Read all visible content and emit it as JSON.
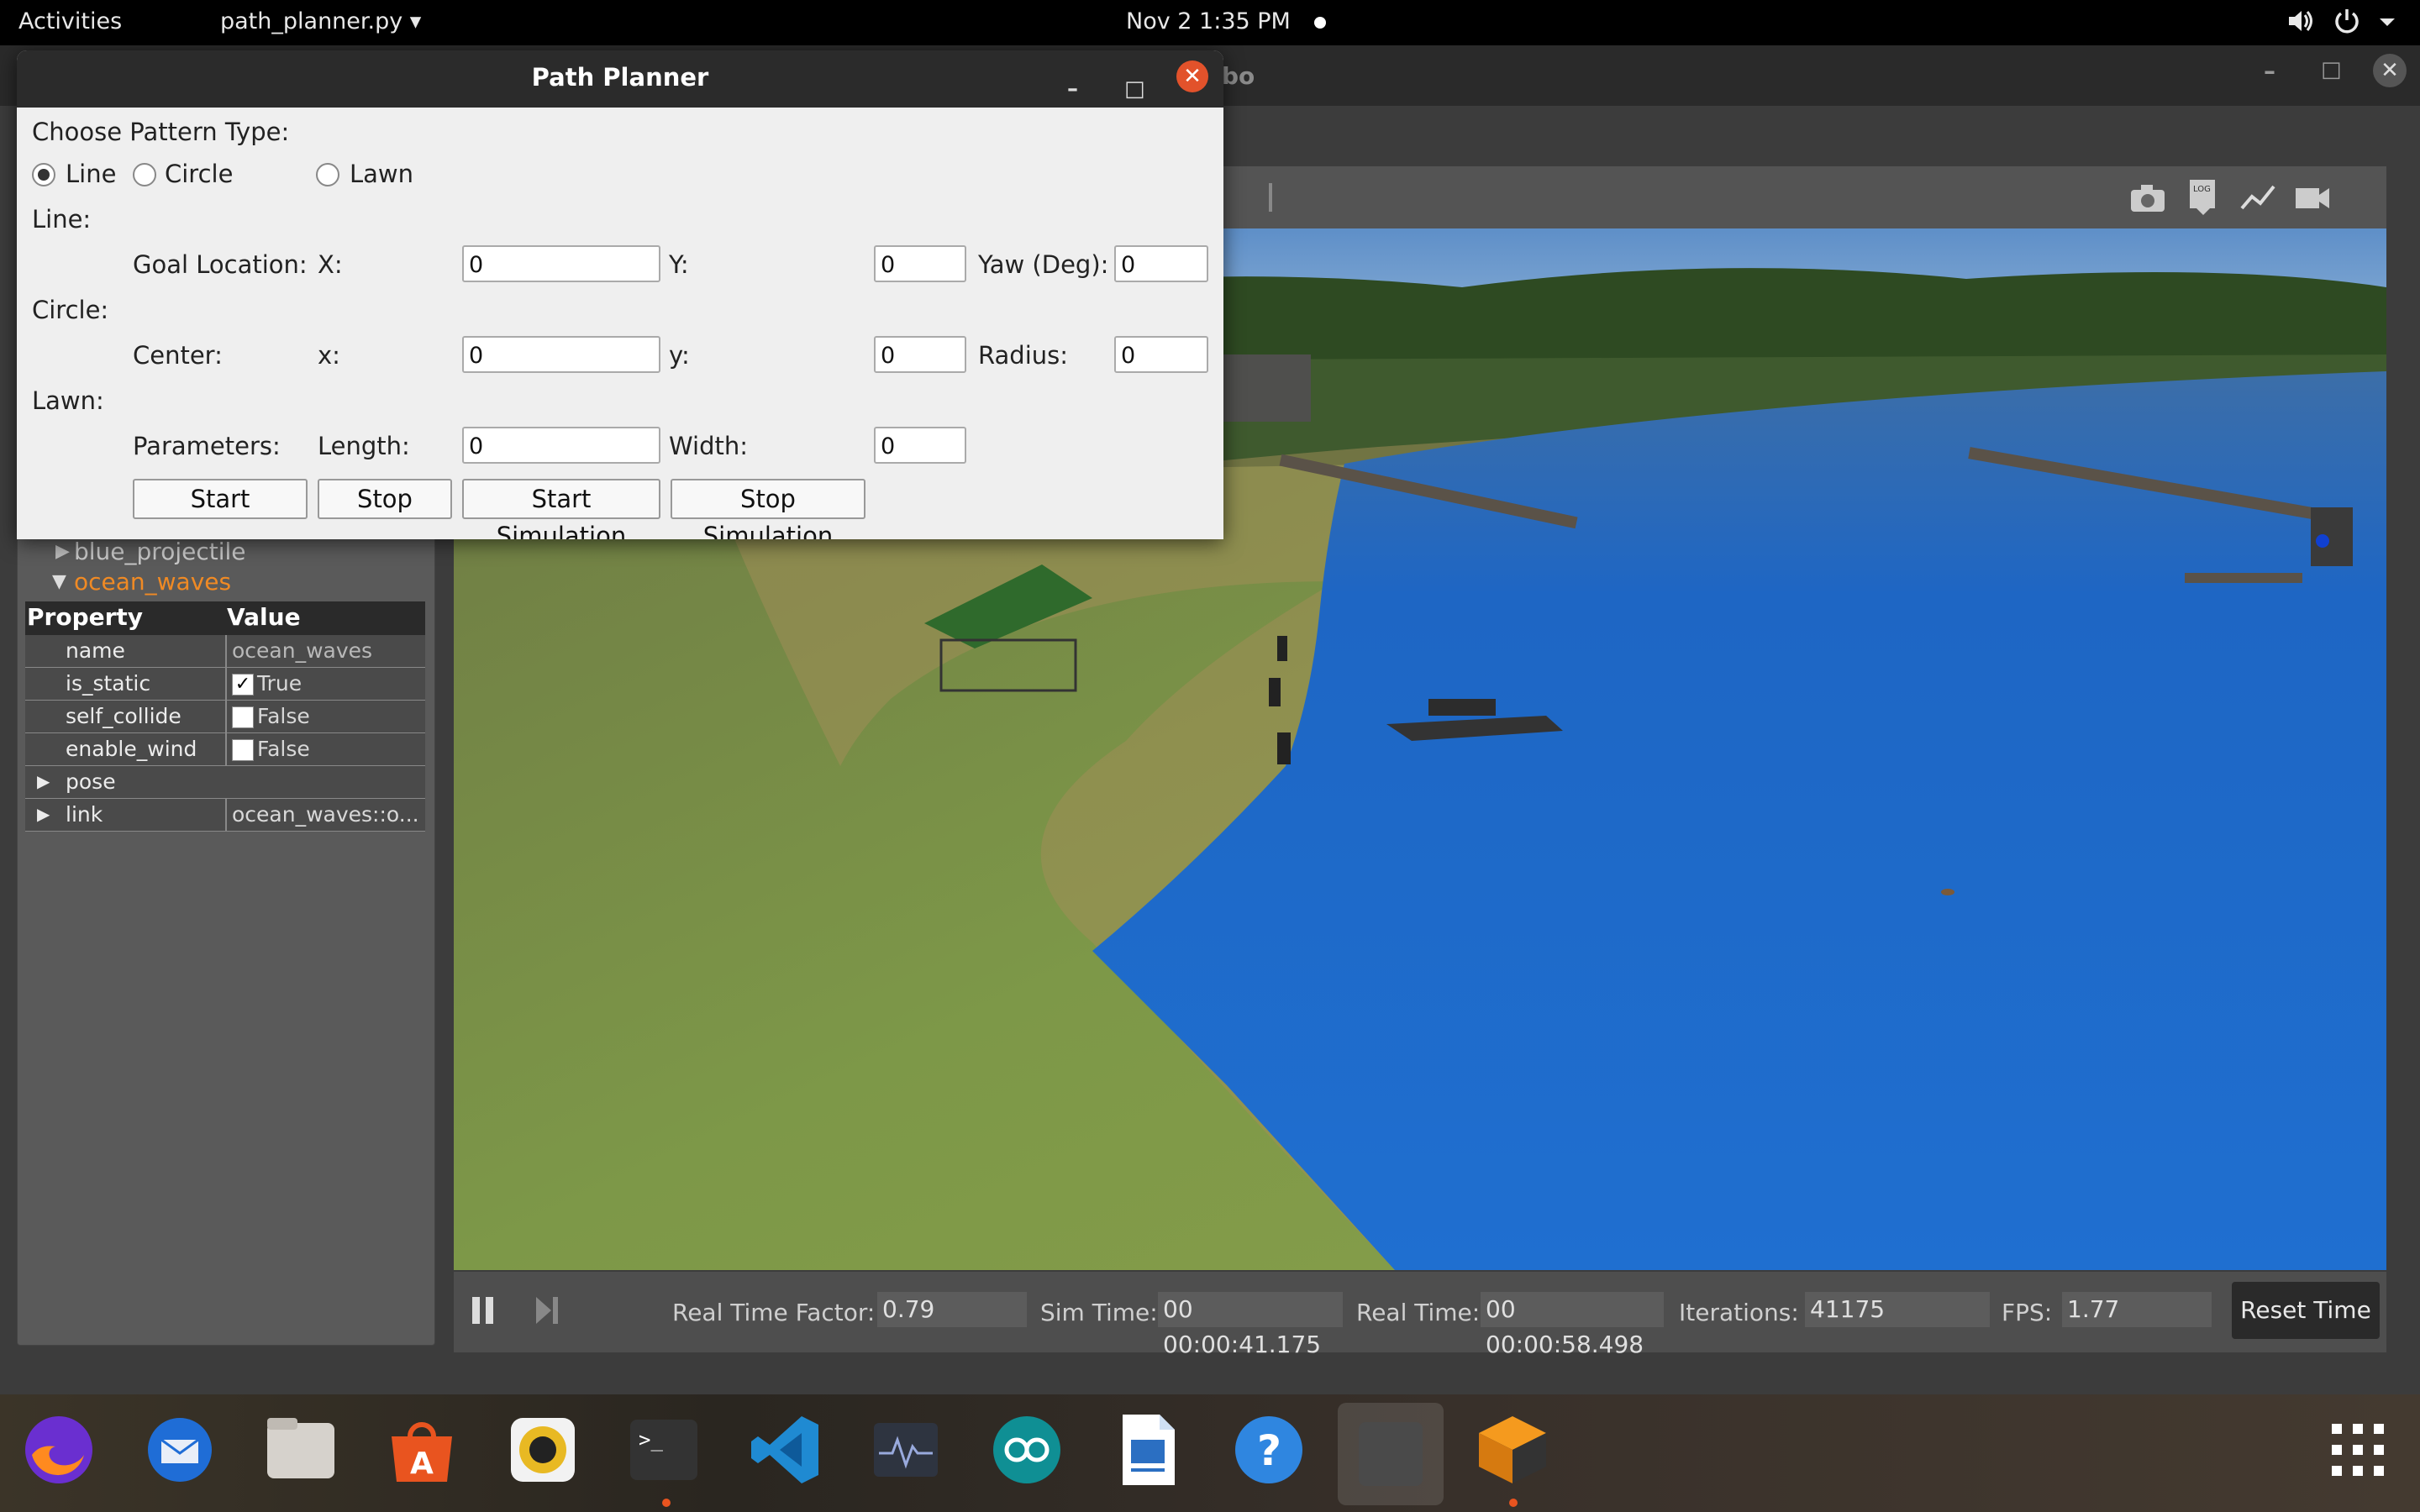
{
  "topbar": {
    "activities": "Activities",
    "app_menu": "path_planner.py ▾",
    "clock": "Nov 2  1:35 PM",
    "volume_icon": "volume-icon",
    "power_icon": "power-icon"
  },
  "gazebo": {
    "title_partial": "bo",
    "tree": {
      "item1": "blue_projectile",
      "item2": "ocean_waves"
    },
    "properties": {
      "col_property": "Property",
      "col_value": "Value",
      "rows": [
        {
          "key": "name",
          "value": "ocean_waves"
        },
        {
          "key": "is_static",
          "value": "True",
          "checked": true
        },
        {
          "key": "self_collide",
          "value": "False",
          "checked": false
        },
        {
          "key": "enable_wind",
          "value": "False",
          "checked": false
        },
        {
          "key": "pose",
          "value": ""
        },
        {
          "key": "link",
          "value": "ocean_waves::o..."
        }
      ]
    },
    "status": {
      "rtf_label": "Real Time Factor:",
      "rtf_value": "0.79",
      "sim_label": "Sim Time:",
      "sim_value": "00 00:00:41.175",
      "real_label": "Real Time:",
      "real_value": "00 00:00:58.498",
      "iter_label": "Iterations:",
      "iter_value": "41175",
      "fps_label": "FPS:",
      "fps_value": "1.77",
      "reset_label": "Reset Time"
    }
  },
  "dialog": {
    "title": "Path Planner",
    "choose_label": "Choose Pattern Type:",
    "radios": {
      "line": "Line",
      "circle": "Circle",
      "lawn": "Lawn",
      "selected": "line"
    },
    "line_section": "Line:",
    "goal_label": "Goal Location:",
    "x_label": "X:",
    "x_value": "0",
    "y_label": "Y:",
    "y_value": "0",
    "yaw_label": "Yaw (Deg):",
    "yaw_value": "0",
    "circle_section": "Circle:",
    "center_label": "Center:",
    "cx_label": "x:",
    "cx_value": "0",
    "cy_label": "y:",
    "cy_value": "0",
    "radius_label": "Radius:",
    "radius_value": "0",
    "lawn_section": "Lawn:",
    "params_label": "Parameters:",
    "length_label": "Length:",
    "length_value": "0",
    "width_label": "Width:",
    "width_value": "0",
    "buttons": {
      "start": "Start",
      "stop": "Stop",
      "start_sim": "Start Simulation",
      "stop_sim": "Stop Simulation"
    }
  },
  "dock": {
    "apps": [
      "firefox-icon",
      "thunderbird-icon",
      "files-icon",
      "app-center-icon",
      "rhythmbox-icon",
      "terminal-icon",
      "vscode-icon",
      "system-monitor-icon",
      "arduino-icon",
      "writer-icon",
      "help-icon",
      "gazebo-blank-icon",
      "gazebo-icon"
    ],
    "show_apps": "show-apps-icon"
  },
  "colors": {
    "accent_orange": "#f08a24",
    "close_red": "#e2522b",
    "water": "#1f6fc8"
  }
}
